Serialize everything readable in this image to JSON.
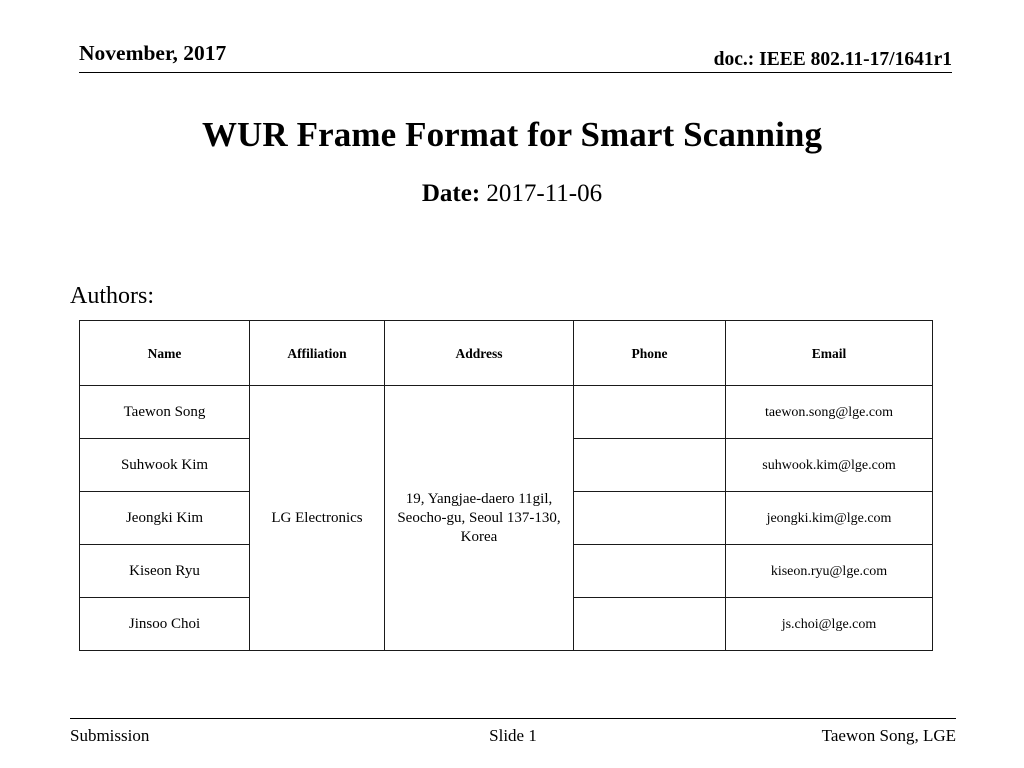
{
  "page": {
    "background_color": "#ffffff",
    "text_color": "#000000"
  },
  "header": {
    "date_label": "November, 2017",
    "doc_label": "doc.: IEEE 802.11-17/1641r1"
  },
  "title": {
    "main": "WUR Frame Format for Smart Scanning",
    "date_prefix": "Date:",
    "date_value": "2017-11-06"
  },
  "authors_section": {
    "label": "Authors:",
    "table": {
      "columns": [
        "Name",
        "Affiliation",
        "Address",
        "Phone",
        "Email"
      ],
      "affiliation": "LG Electronics",
      "address": "19, Yangjae-daero 11gil, Seocho-gu, Seoul 137-130, Korea",
      "rows": [
        {
          "name": "Taewon Song",
          "phone": "",
          "email": "taewon.song@lge.com"
        },
        {
          "name": "Suhwook Kim",
          "phone": "",
          "email": "suhwook.kim@lge.com"
        },
        {
          "name": "Jeongki Kim",
          "phone": "",
          "email": "jeongki.kim@lge.com"
        },
        {
          "name": "Kiseon Ryu",
          "phone": "",
          "email": "kiseon.ryu@lge.com"
        },
        {
          "name": "Jinsoo Choi",
          "phone": "",
          "email": "js.choi@lge.com"
        }
      ]
    }
  },
  "footer": {
    "left": "Submission",
    "center": "Slide 1",
    "right": "Taewon Song, LGE"
  }
}
